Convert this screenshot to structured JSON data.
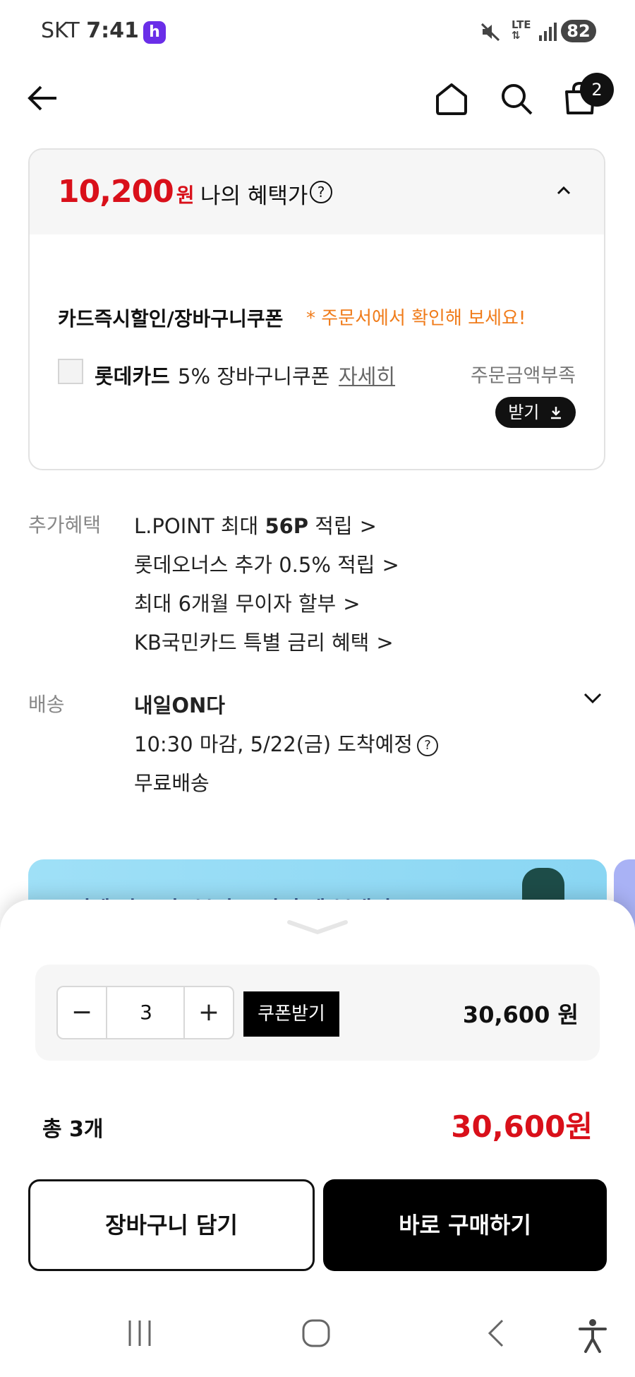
{
  "status_bar": {
    "carrier": "SKT",
    "time": "7:41",
    "app_icon_letter": "h",
    "network": "LTE",
    "battery": "82"
  },
  "header": {
    "cart_count": "2",
    "icons": [
      "back-arrow-icon",
      "home-icon",
      "search-icon",
      "cart-icon"
    ]
  },
  "benefit": {
    "price": "10,200",
    "price_unit": "원",
    "price_label": "나의 혜택가",
    "help": "?",
    "coupon_title": "카드즉시할인/장바구니쿠폰",
    "coupon_note": "* 주문서에서 확인해 보세요!",
    "card_name": "롯데카드",
    "card_desc": "5% 장바구니쿠폰",
    "detail_link": "자세히",
    "min_order_note": "주문금액부족",
    "receive_label": "받기"
  },
  "extra_benefits": {
    "label": "추가혜택",
    "items": [
      {
        "pre": "L.POINT 최대 ",
        "bold": "56P",
        "post": " 적립"
      },
      {
        "pre": "롯데오너스 추가 0.5% 적립",
        "bold": "",
        "post": ""
      },
      {
        "pre": "최대 6개월 무이자 할부",
        "bold": "",
        "post": ""
      },
      {
        "pre": "KB국민카드 특별 금리 혜택",
        "bold": "",
        "post": ""
      }
    ],
    "chevron": ">"
  },
  "delivery": {
    "label": "배송",
    "title": "내일ON다",
    "schedule": "10:30 마감, 5/22(금) 도착예정",
    "fee": "무료배송"
  },
  "banner": {
    "text": "1년에 단 4번, 뷰티 스킨 축제 부내기"
  },
  "order": {
    "quantity": "3",
    "minus": "−",
    "plus": "+",
    "coupon_button": "쿠폰받기",
    "line_price": "30,600",
    "unit": "원",
    "total_label": "총 3개",
    "total_price": "30,600",
    "cart_button": "장바구니 담기",
    "buy_button": "바로 구매하기"
  },
  "colors": {
    "accent_red": "#d9101a",
    "note_orange": "#f07c1b",
    "black": "#000000"
  }
}
